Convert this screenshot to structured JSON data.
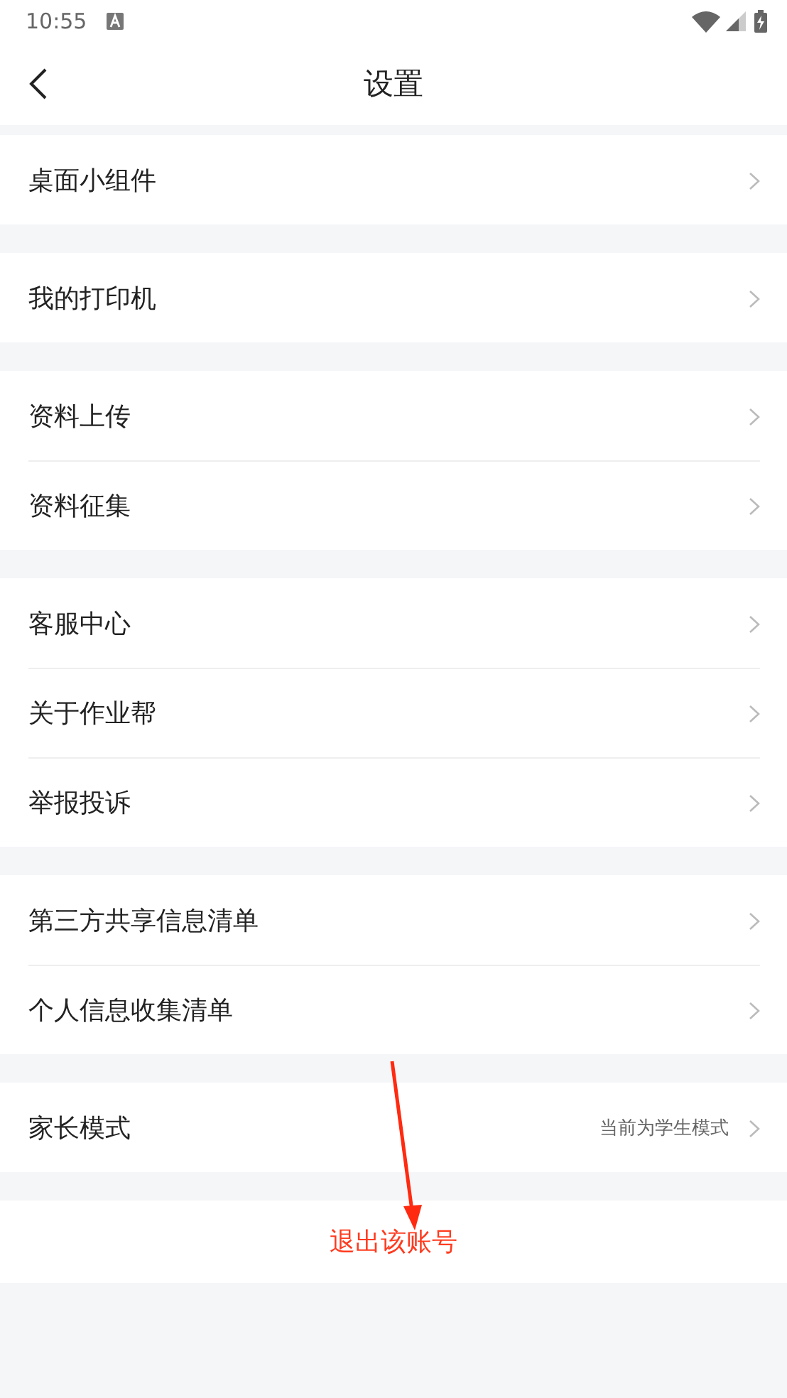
{
  "status_bar": {
    "time": "10:55"
  },
  "header": {
    "title": "设置"
  },
  "groups": [
    {
      "items": [
        {
          "label": "桌面小组件"
        }
      ]
    },
    {
      "items": [
        {
          "label": "我的打印机"
        }
      ]
    },
    {
      "items": [
        {
          "label": "资料上传"
        },
        {
          "label": "资料征集"
        }
      ]
    },
    {
      "items": [
        {
          "label": "客服中心"
        },
        {
          "label": "关于作业帮"
        },
        {
          "label": "举报投诉"
        }
      ]
    },
    {
      "items": [
        {
          "label": "第三方共享信息清单"
        },
        {
          "label": "个人信息收集清单"
        }
      ]
    },
    {
      "items": [
        {
          "label": "家长模式",
          "value": "当前为学生模式"
        }
      ]
    }
  ],
  "logout_button": {
    "label": "退出该账号"
  }
}
